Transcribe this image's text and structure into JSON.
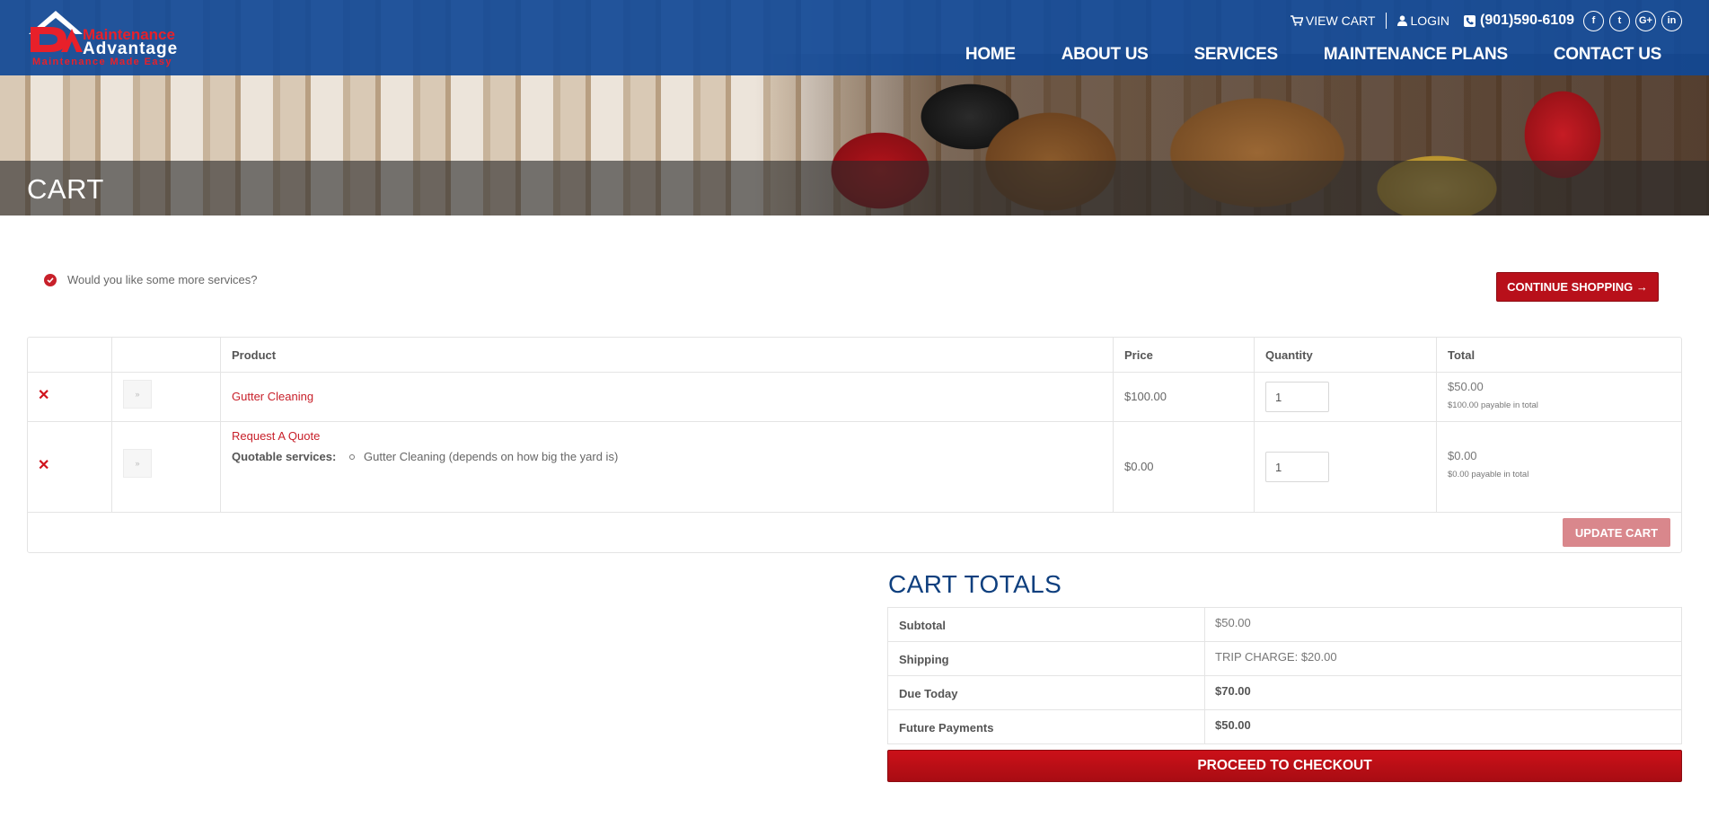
{
  "brand": {
    "name_line1": "Maintenance",
    "name_line2": "Advantage",
    "tagline": "Maintenance Made Easy",
    "colors": {
      "primary_blue": "#104896",
      "accent_red": "#c8202a"
    }
  },
  "utility": {
    "view_cart": "VIEW CART",
    "login": "LOGIN",
    "phone": "(901)590-6109",
    "social": [
      {
        "icon": "facebook-icon",
        "glyph": "f"
      },
      {
        "icon": "twitter-icon",
        "glyph": "t"
      },
      {
        "icon": "google-plus-icon",
        "glyph": "G+"
      },
      {
        "icon": "linkedin-icon",
        "glyph": "in"
      }
    ]
  },
  "nav": {
    "items": [
      "HOME",
      "ABOUT US",
      "SERVICES",
      "MAINTENANCE PLANS",
      "CONTACT US"
    ]
  },
  "page": {
    "title": "CART"
  },
  "notice": {
    "message": "Would you like some more services?",
    "continue_label": "CONTINUE SHOPPING →"
  },
  "cart": {
    "headers": {
      "product": "Product",
      "price": "Price",
      "quantity": "Quantity",
      "total": "Total"
    },
    "rows": [
      {
        "product": "Gutter Cleaning",
        "price": "$100.00",
        "quantity": "1",
        "total": "$50.00",
        "total_note": "$100.00 payable in total"
      },
      {
        "product": "Request A Quote",
        "quotable_label": "Quotable services:",
        "quotable_item": "Gutter Cleaning (depends on how big the yard is)",
        "price": "$0.00",
        "quantity": "1",
        "total": "$0.00",
        "total_note": "$0.00 payable in total"
      }
    ],
    "update_label": "UPDATE CART"
  },
  "totals": {
    "title": "CART TOTALS",
    "rows": [
      {
        "label": "Subtotal",
        "value": "$50.00"
      },
      {
        "label": "Shipping",
        "value": "TRIP CHARGE: $20.00"
      },
      {
        "label": "Due Today",
        "value": "$70.00"
      },
      {
        "label": "Future Payments",
        "value": "$50.00"
      }
    ],
    "checkout_label": "PROCEED TO CHECKOUT"
  }
}
